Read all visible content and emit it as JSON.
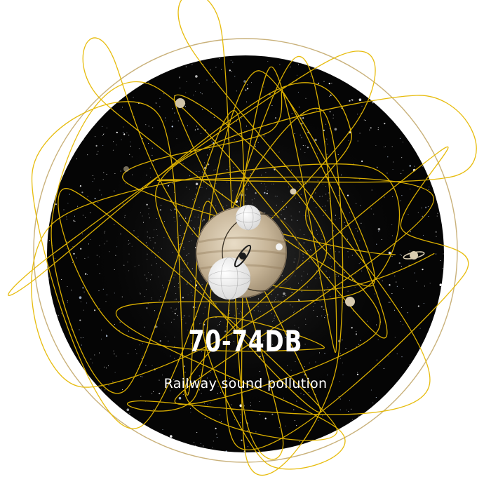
{
  "poster": {
    "decibel_range": "70-74DB",
    "caption": "Railway sound pollution"
  },
  "colors": {
    "background": "#ffffff",
    "sky": "#050505",
    "outer_ring": "#c9b17a",
    "sound_wave": "#e6b800",
    "planet": "#c8b89e",
    "text": "#ffffff"
  },
  "icons": [
    "planet-icon",
    "ringed-planet-icon",
    "moon-icon",
    "star-field"
  ]
}
